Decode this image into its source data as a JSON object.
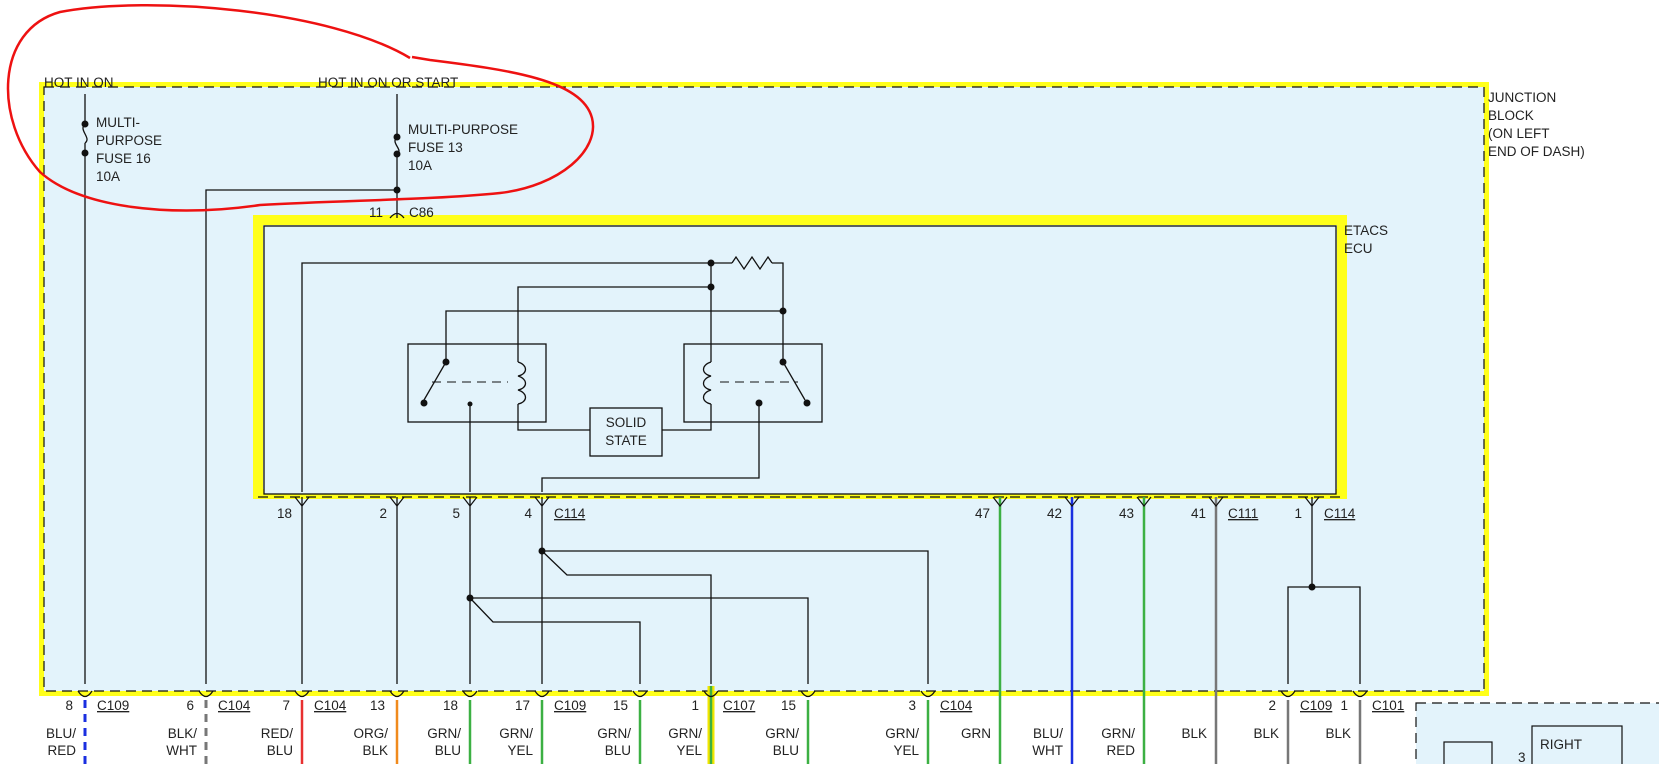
{
  "colors": {
    "block_fill": "#e3f3fb",
    "highlight": "#ffff1a",
    "annotation": "#ee1111",
    "wire_blue": "#1a2fe0",
    "wire_red": "#e83030",
    "wire_green": "#3cb043",
    "wire_orange": "#f08a1d",
    "wire_gray": "#777777",
    "wire_yellow": "#f2e600"
  },
  "labels": {
    "hot_in_on": "HOT IN ON",
    "hot_in_on_or_start": "HOT IN ON OR START",
    "fuse16": [
      "MULTI-",
      "PURPOSE",
      "FUSE 16",
      "10A"
    ],
    "fuse13": [
      "MULTI-PURPOSE",
      "FUSE 13",
      "10A"
    ],
    "junction_block": [
      "JUNCTION",
      "BLOCK",
      "(ON LEFT",
      "END OF DASH)"
    ],
    "etacs_ecu": [
      "ETACS",
      "ECU"
    ],
    "solid_state": [
      "SOLID",
      "STATE"
    ],
    "c86_pin": "11",
    "c86": "C86",
    "right": "RIGHT",
    "right_pin": "3"
  },
  "ecu_pins": [
    {
      "pin": "18",
      "connector": ""
    },
    {
      "pin": "2",
      "connector": ""
    },
    {
      "pin": "5",
      "connector": ""
    },
    {
      "pin": "4",
      "connector": "C114"
    },
    {
      "pin": "47",
      "connector": ""
    },
    {
      "pin": "42",
      "connector": ""
    },
    {
      "pin": "43",
      "connector": ""
    },
    {
      "pin": "41",
      "connector": "C111"
    },
    {
      "pin": "1",
      "connector": "C114"
    }
  ],
  "bottom_pins": [
    {
      "pin": "8",
      "connector": "C109",
      "wire": [
        "BLU/",
        "RED"
      ]
    },
    {
      "pin": "6",
      "connector": "C104",
      "wire": [
        "BLK/",
        "WHT"
      ]
    },
    {
      "pin": "7",
      "connector": "C104",
      "wire": [
        "RED/",
        "BLU"
      ]
    },
    {
      "pin": "13",
      "connector": "",
      "wire": [
        "ORG/",
        "BLK"
      ]
    },
    {
      "pin": "18",
      "connector": "",
      "wire": [
        "GRN/",
        "BLU"
      ]
    },
    {
      "pin": "17",
      "connector": "C109",
      "wire": [
        "GRN/",
        "YEL"
      ]
    },
    {
      "pin": "15",
      "connector": "",
      "wire": [
        "GRN/",
        "BLU"
      ]
    },
    {
      "pin": "1",
      "connector": "C107",
      "wire": [
        "GRN/",
        "YEL"
      ]
    },
    {
      "pin": "15",
      "connector": "",
      "wire": [
        "GRN/",
        "BLU"
      ]
    },
    {
      "pin": "3",
      "connector": "C104",
      "wire": [
        "GRN/",
        "YEL"
      ]
    },
    {
      "pin": "",
      "connector": "",
      "wire": [
        "GRN",
        ""
      ]
    },
    {
      "pin": "",
      "connector": "",
      "wire": [
        "BLU/",
        "WHT"
      ]
    },
    {
      "pin": "",
      "connector": "",
      "wire": [
        "GRN/",
        "RED"
      ]
    },
    {
      "pin": "",
      "connector": "",
      "wire": [
        "BLK",
        ""
      ]
    },
    {
      "pin": "2",
      "connector": "C109",
      "wire": [
        "BLK",
        ""
      ]
    },
    {
      "pin": "1",
      "connector": "C101",
      "wire": [
        "BLK",
        ""
      ]
    }
  ]
}
